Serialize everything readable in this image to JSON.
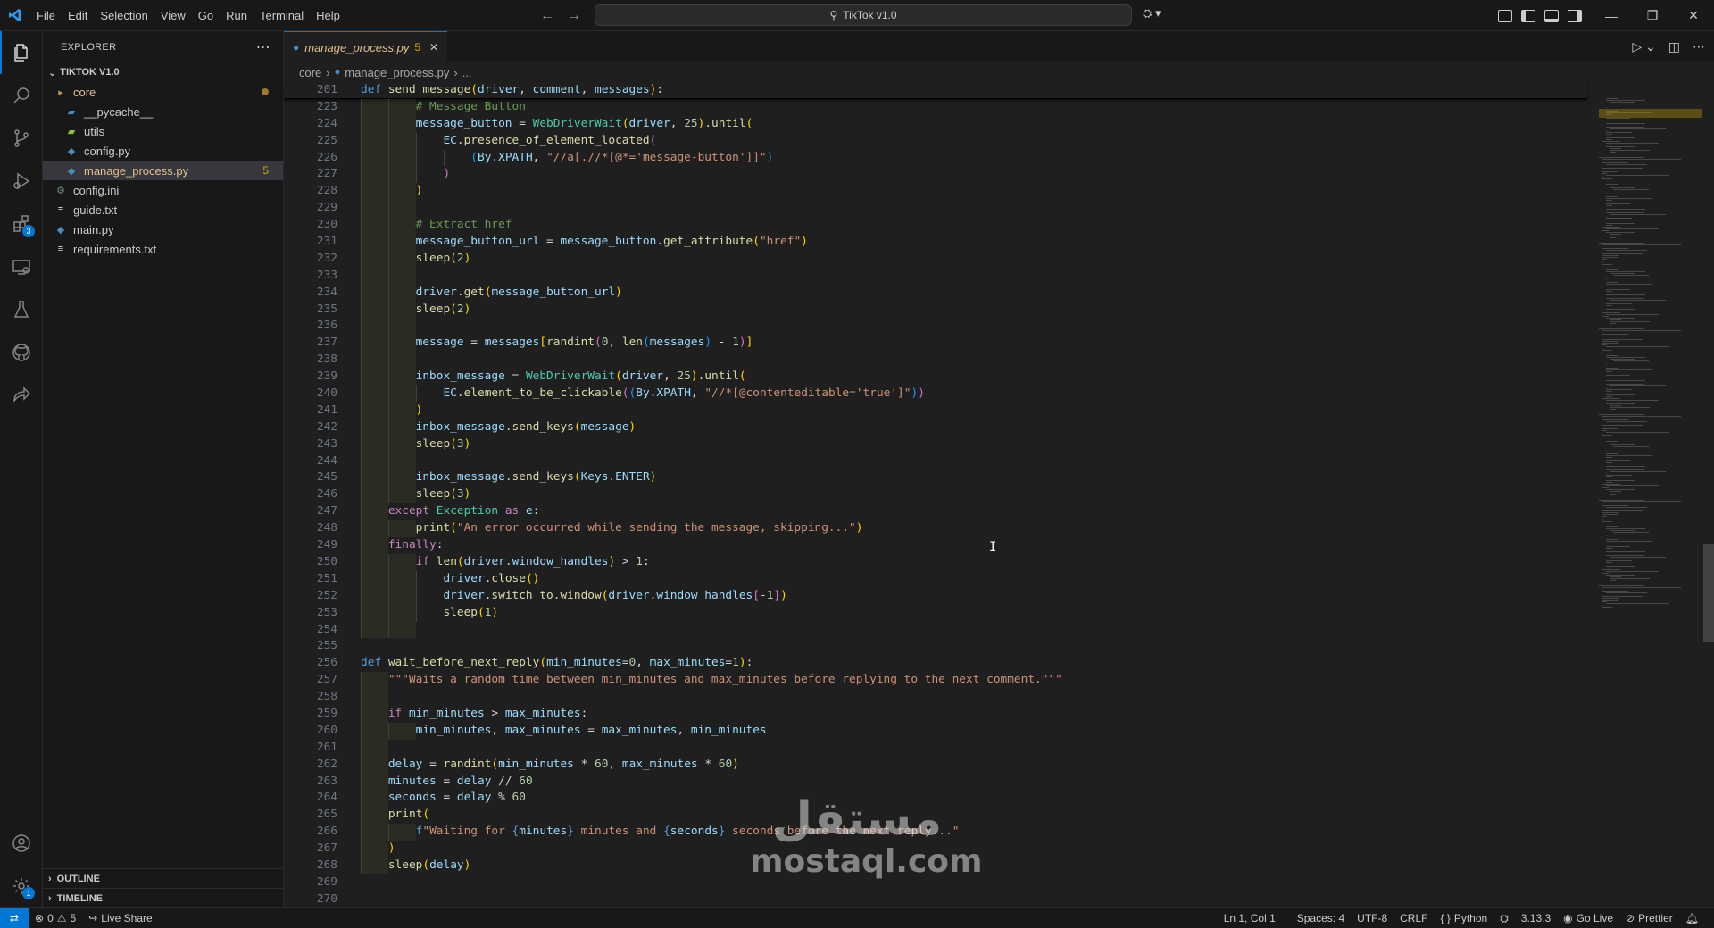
{
  "titlebar": {
    "menu": [
      "File",
      "Edit",
      "Selection",
      "View",
      "Go",
      "Run",
      "Terminal",
      "Help"
    ],
    "search": "TikTok v1.0"
  },
  "activitybar": {
    "items": [
      "explorer-icon",
      "search-icon",
      "source-control-icon",
      "run-debug-icon",
      "extensions-icon",
      "remote-explorer-icon",
      "testing-icon",
      "github-icon",
      "live-share-icon"
    ],
    "extensions_badge": "3",
    "settings_badge": "1"
  },
  "sidebar": {
    "title": "EXPLORER",
    "project": "TIKTOK V1.0",
    "tree": [
      {
        "label": "core",
        "kind": "folder",
        "depth": 0,
        "color": "#e2c08d"
      },
      {
        "label": "__pycache__",
        "kind": "folder-special",
        "depth": 1,
        "color": "#cccccc"
      },
      {
        "label": "utils",
        "kind": "folder-green",
        "depth": 1,
        "color": "#cccccc"
      },
      {
        "label": "config.py",
        "kind": "python",
        "depth": 1,
        "color": "#cccccc"
      },
      {
        "label": "manage_process.py",
        "kind": "python",
        "depth": 1,
        "color": "#e2c08d",
        "count": "5"
      },
      {
        "label": "config.ini",
        "kind": "gear",
        "depth": 0,
        "color": "#cccccc"
      },
      {
        "label": "guide.txt",
        "kind": "text",
        "depth": 0,
        "color": "#cccccc"
      },
      {
        "label": "main.py",
        "kind": "python",
        "depth": 0,
        "color": "#cccccc"
      },
      {
        "label": "requirements.txt",
        "kind": "text",
        "depth": 0,
        "color": "#cccccc"
      }
    ],
    "outline": "OUTLINE",
    "timeline": "TIMELINE"
  },
  "editor": {
    "tab": {
      "name": "manage_process.py",
      "count": "5"
    },
    "breadcrumb": [
      "core",
      "manage_process.py",
      "..."
    ],
    "sticky": {
      "no": "201",
      "html": "<span class='k'>def</span> <span class='f'>send_message</span><span class='b1'>(</span><span class='v'>driver</span>, <span class='v'>comment</span>, <span class='v'>messages</span><span class='b1'>)</span>:"
    },
    "lines": [
      {
        "no": "223",
        "ind": 2,
        "html": "<span class='cm'># Message Button</span>"
      },
      {
        "no": "224",
        "ind": 2,
        "html": "<span class='v'>message_button</span> = <span class='t'>WebDriverWait</span><span class='b1'>(</span><span class='v'>driver</span>, <span class='n'>25</span><span class='b1'>)</span>.<span class='f'>until</span><span class='b1'>(</span>"
      },
      {
        "no": "225",
        "ind": 3,
        "html": "<span class='v'>EC</span>.<span class='f'>presence_of_element_located</span><span class='b2'>(</span>"
      },
      {
        "no": "226",
        "ind": 4,
        "html": "<span class='b3'>(</span><span class='v'>By</span>.<span class='v'>XPATH</span>, <span class='s'>\"//a[.//*[@*='message-button']]\"</span><span class='b3'>)</span>"
      },
      {
        "no": "227",
        "ind": 3,
        "html": "<span class='b2'>)</span>"
      },
      {
        "no": "228",
        "ind": 2,
        "html": "<span class='b1'>)</span>"
      },
      {
        "no": "229",
        "ind": 2,
        "html": ""
      },
      {
        "no": "230",
        "ind": 2,
        "html": "<span class='cm'># Extract href</span>"
      },
      {
        "no": "231",
        "ind": 2,
        "html": "<span class='v'>message_button_url</span> = <span class='v'>message_button</span>.<span class='f'>get_attribute</span><span class='b1'>(</span><span class='s'>\"href\"</span><span class='b1'>)</span>"
      },
      {
        "no": "232",
        "ind": 2,
        "html": "<span class='f'>sleep</span><span class='b1'>(</span><span class='n'>2</span><span class='b1'>)</span>"
      },
      {
        "no": "233",
        "ind": 2,
        "html": ""
      },
      {
        "no": "234",
        "ind": 2,
        "html": "<span class='v'>driver</span>.<span class='f'>get</span><span class='b1'>(</span><span class='v'>message_button_url</span><span class='b1'>)</span>"
      },
      {
        "no": "235",
        "ind": 2,
        "html": "<span class='f'>sleep</span><span class='b1'>(</span><span class='n'>2</span><span class='b1'>)</span>"
      },
      {
        "no": "236",
        "ind": 2,
        "html": ""
      },
      {
        "no": "237",
        "ind": 2,
        "html": "<span class='v'>message</span> = <span class='v'>messages</span><span class='b1'>[</span><span class='f'>randint</span><span class='b2'>(</span><span class='n'>0</span>, <span class='f'>len</span><span class='b3'>(</span><span class='v'>messages</span><span class='b3'>)</span> - <span class='n'>1</span><span class='b2'>)</span><span class='b1'>]</span>"
      },
      {
        "no": "238",
        "ind": 2,
        "html": ""
      },
      {
        "no": "239",
        "ind": 2,
        "html": "<span class='v'>inbox_message</span> = <span class='t'>WebDriverWait</span><span class='b1'>(</span><span class='v'>driver</span>, <span class='n'>25</span><span class='b1'>)</span>.<span class='f'>until</span><span class='b1'>(</span>"
      },
      {
        "no": "240",
        "ind": 3,
        "html": "<span class='v'>EC</span>.<span class='f'>element_to_be_clickable</span><span class='b2'>(</span><span class='b3'>(</span><span class='v'>By</span>.<span class='v'>XPATH</span>, <span class='s'>\"//*[@contenteditable='true']\"</span><span class='b3'>)</span><span class='b2'>)</span>"
      },
      {
        "no": "241",
        "ind": 2,
        "html": "<span class='b1'>)</span>"
      },
      {
        "no": "242",
        "ind": 2,
        "html": "<span class='v'>inbox_message</span>.<span class='f'>send_keys</span><span class='b1'>(</span><span class='v'>message</span><span class='b1'>)</span>"
      },
      {
        "no": "243",
        "ind": 2,
        "html": "<span class='f'>sleep</span><span class='b1'>(</span><span class='n'>3</span><span class='b1'>)</span>"
      },
      {
        "no": "244",
        "ind": 2,
        "html": ""
      },
      {
        "no": "245",
        "ind": 2,
        "html": "<span class='v'>inbox_message</span>.<span class='f'>send_keys</span><span class='b1'>(</span><span class='v'>Keys</span>.<span class='v'>ENTER</span><span class='b1'>)</span>"
      },
      {
        "no": "246",
        "ind": 2,
        "html": "<span class='f'>sleep</span><span class='b1'>(</span><span class='n'>3</span><span class='b1'>)</span>"
      },
      {
        "no": "247",
        "ind": 1,
        "html": "<span class='c'>except</span> <span class='t'>Exception</span> <span class='c'>as</span> <span class='v'>e</span>:"
      },
      {
        "no": "248",
        "ind": 2,
        "html": "<span class='f'>print</span><span class='b1'>(</span><span class='s'>\"An error occurred while sending the message, skipping...\"</span><span class='b1'>)</span>"
      },
      {
        "no": "249",
        "ind": 1,
        "html": "<span class='c'>finally</span>:"
      },
      {
        "no": "250",
        "ind": 2,
        "html": "<span class='c'>if</span> <span class='f'>len</span><span class='b1'>(</span><span class='v'>driver</span>.<span class='v'>window_handles</span><span class='b1'>)</span> &gt; <span class='n'>1</span>:"
      },
      {
        "no": "251",
        "ind": 3,
        "html": "<span class='v'>driver</span>.<span class='f'>close</span><span class='b1'>()</span>"
      },
      {
        "no": "252",
        "ind": 3,
        "html": "<span class='v'>driver</span>.<span class='f'>switch_to</span>.<span class='f'>window</span><span class='b1'>(</span><span class='v'>driver</span>.<span class='v'>window_handles</span><span class='b2'>[</span>-<span class='n'>1</span><span class='b2'>]</span><span class='b1'>)</span>"
      },
      {
        "no": "253",
        "ind": 3,
        "html": "<span class='f'>sleep</span><span class='b1'>(</span><span class='n'>1</span><span class='b1'>)</span>"
      },
      {
        "no": "254",
        "ind": 2,
        "html": ""
      },
      {
        "no": "255",
        "ind": 0,
        "html": ""
      },
      {
        "no": "256",
        "ind": 0,
        "html": "<span class='k'>def</span> <span class='f'>wait_before_next_reply</span><span class='b1'>(</span><span class='v'>min_minutes</span>=<span class='n'>0</span>, <span class='v'>max_minutes</span>=<span class='n'>1</span><span class='b1'>)</span>:"
      },
      {
        "no": "257",
        "ind": 1,
        "html": "<span class='s'>\"\"\"Waits a random time between min_minutes and max_minutes before replying to the next comment.\"\"\"</span>"
      },
      {
        "no": "258",
        "ind": 1,
        "html": ""
      },
      {
        "no": "259",
        "ind": 1,
        "html": "<span class='c'>if</span> <span class='v'>min_minutes</span> &gt; <span class='v'>max_minutes</span>:"
      },
      {
        "no": "260",
        "ind": 2,
        "html": "<span class='v'>min_minutes</span>, <span class='v'>max_minutes</span> = <span class='v'>max_minutes</span>, <span class='v'>min_minutes</span>"
      },
      {
        "no": "261",
        "ind": 1,
        "html": ""
      },
      {
        "no": "262",
        "ind": 1,
        "html": "<span class='v'>delay</span> = <span class='f'>randint</span><span class='b1'>(</span><span class='v'>min_minutes</span> * <span class='n'>60</span>, <span class='v'>max_minutes</span> * <span class='n'>60</span><span class='b1'>)</span>"
      },
      {
        "no": "263",
        "ind": 1,
        "html": "<span class='v'>minutes</span> = <span class='v'>delay</span> // <span class='n'>60</span>"
      },
      {
        "no": "264",
        "ind": 1,
        "html": "<span class='v'>seconds</span> = <span class='v'>delay</span> % <span class='n'>60</span>"
      },
      {
        "no": "265",
        "ind": 1,
        "html": "<span class='f'>print</span><span class='b1'>(</span>"
      },
      {
        "no": "266",
        "ind": 2,
        "html": "<span class='k'>f</span><span class='s'>\"Waiting for </span><span class='k'>{</span><span class='v'>minutes</span><span class='k'>}</span><span class='s'> minutes and </span><span class='k'>{</span><span class='v'>seconds</span><span class='k'>}</span><span class='s'> seconds before the next reply...\"</span>"
      },
      {
        "no": "267",
        "ind": 1,
        "html": "<span class='b1'>)</span>"
      },
      {
        "no": "268",
        "ind": 1,
        "html": "<span class='f'>sleep</span><span class='b1'>(</span><span class='v'>delay</span><span class='b1'>)</span>"
      },
      {
        "no": "269",
        "ind": 0,
        "html": ""
      },
      {
        "no": "270",
        "ind": 0,
        "html": ""
      }
    ]
  },
  "watermark": {
    "arabic": "مستقل",
    "latin": "mostaql.com"
  },
  "statusbar": {
    "errors": "0",
    "warnings": "5",
    "live_share": "Live Share",
    "cursor": "Ln 1, Col 1",
    "spaces": "Spaces: 4",
    "encoding": "UTF-8",
    "eol": "CRLF",
    "language": "Python",
    "python_version": "3.13.3",
    "go_live": "Go Live",
    "prettier": "Prettier"
  }
}
